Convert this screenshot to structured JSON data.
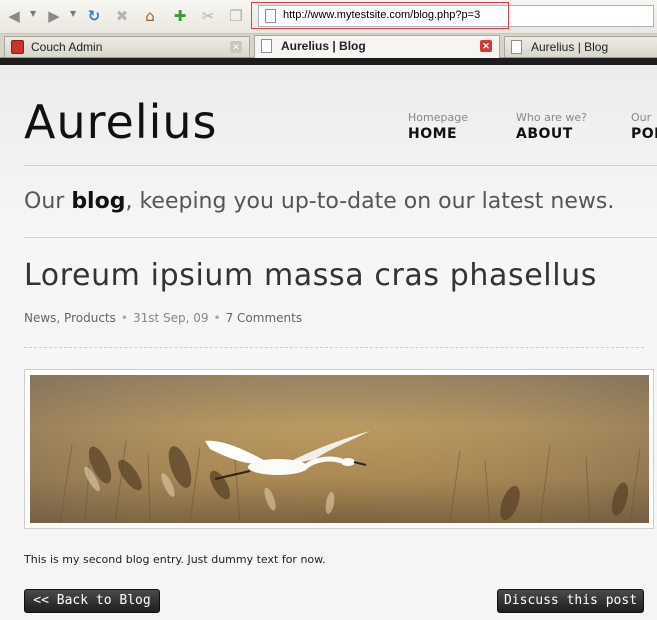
{
  "browser": {
    "url": "http://www.mytestsite.com/blog.php?p=3",
    "tabs": [
      {
        "label": "Couch Admin",
        "icon": "couch-admin-favicon",
        "active": false
      },
      {
        "label": "Aurelius | Blog",
        "icon": "page-icon",
        "active": true
      },
      {
        "label": "Aurelius | Blog",
        "icon": "page-icon",
        "active": false
      }
    ],
    "toolbar_icons": [
      "back-icon",
      "forward-icon",
      "reload-icon",
      "stop-icon",
      "home-icon",
      "new-bookmark-icon",
      "cut-icon",
      "copy-icon"
    ]
  },
  "site": {
    "title": "Aurelius",
    "nav": [
      {
        "sub": "Homepage",
        "label": "HOME"
      },
      {
        "sub": "Who are we?",
        "label": "ABOUT"
      },
      {
        "sub": "Our",
        "label": "POR"
      }
    ],
    "tagline_prefix": "Our ",
    "tagline_bold": "blog",
    "tagline_suffix": ", keeping you up-to-date on our latest news."
  },
  "post": {
    "title": "Loreum ipsium massa cras phasellus",
    "categories": "News, Products",
    "date": "31st Sep, 09",
    "comments": "7 Comments",
    "image": "flying-egret-photo",
    "body": "This is my second blog entry. Just dummy text for now."
  },
  "buttons": {
    "back": "<< Back to Blog",
    "discuss": "Discuss this post"
  },
  "colors": {
    "url_highlight": "#e04040",
    "button_bg": "#2a2a2a",
    "close_tab_red": "#d43a3a"
  }
}
